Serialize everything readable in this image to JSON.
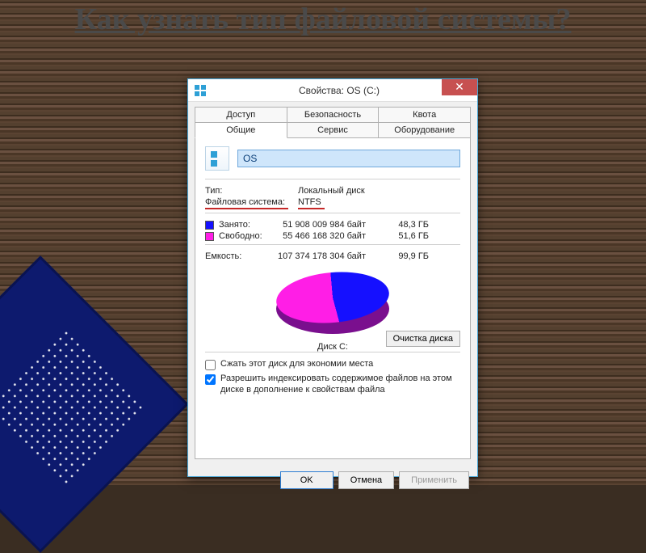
{
  "slide": {
    "title": "Как узнать тип файловой системы?"
  },
  "window": {
    "title": "Свойства: OS (C:)",
    "close_glyph": "✕",
    "tabs_row1": [
      "Доступ",
      "Безопасность",
      "Квота"
    ],
    "tabs_row2": [
      "Общие",
      "Сервис",
      "Оборудование"
    ],
    "active_tab": "Общие"
  },
  "general": {
    "drive_name": "OS",
    "type_label": "Тип:",
    "type_value": "Локальный диск",
    "fs_label": "Файловая система:",
    "fs_value": "NTFS",
    "used_label": "Занято:",
    "used_bytes": "51 908 009 984 байт",
    "used_gb": "48,3 ГБ",
    "free_label": "Свободно:",
    "free_bytes": "55 466 168 320 байт",
    "free_gb": "51,6 ГБ",
    "cap_label": "Емкость:",
    "cap_bytes": "107 374 178 304 байт",
    "cap_gb": "99,9 ГБ",
    "pie_label": "Диск C:",
    "cleanup_button": "Очистка диска",
    "compress_label": "Сжать этот диск для экономии места",
    "index_label": "Разрешить индексировать содержимое файлов на этом диске в дополнение к свойствам файла"
  },
  "buttons": {
    "ok": "OK",
    "cancel": "Отмена",
    "apply": "Применить"
  },
  "chart_data": {
    "type": "pie",
    "title": "Диск C:",
    "series": [
      {
        "name": "Занято",
        "value_bytes": 51908009984,
        "value_gb": 48.3,
        "color": "#1510ff"
      },
      {
        "name": "Свободно",
        "value_bytes": 55466168320,
        "value_gb": 51.6,
        "color": "#ff1ee6"
      }
    ],
    "total_bytes": 107374178304,
    "total_gb": 99.9
  }
}
